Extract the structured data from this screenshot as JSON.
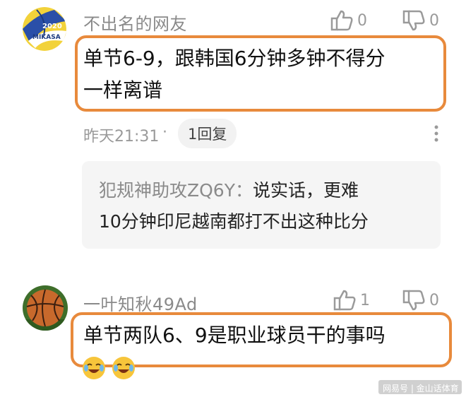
{
  "comments": [
    {
      "username": "不出名的网友",
      "avatar": "volleyball-avatar",
      "avatar_text": "2020 MIKASA",
      "likes": "0",
      "dislikes": "0",
      "text_line1": "单节6-9，跟韩国6分钟多钟不得分",
      "text_line2": "一样离谱",
      "time": "昨天21:31",
      "dot": "·",
      "reply_count_label": "1回复",
      "more_icon": "more-vertical-icon",
      "reply": {
        "author": "犯规神助攻ZQ6Y：",
        "text_line1": "说实话，更难",
        "text_line2": "10分钟印尼越南都打不出这种比分"
      }
    },
    {
      "username": "一叶知秋49Ad",
      "avatar": "basketball-avatar",
      "likes": "1",
      "dislikes": "0",
      "text": "单节两队6、9是职业球员干的事吗",
      "emojis": [
        "crying-laughing-emoji",
        "crying-laughing-emoji"
      ]
    }
  ],
  "watermark": "网易号 | 金山话体育",
  "colors": {
    "highlight_border": "#e88a3c",
    "muted_text": "#8a8a8a",
    "reply_bg": "#f5f5f5"
  },
  "icons": {
    "like": "thumbs-up-icon",
    "dislike": "thumbs-down-icon"
  }
}
